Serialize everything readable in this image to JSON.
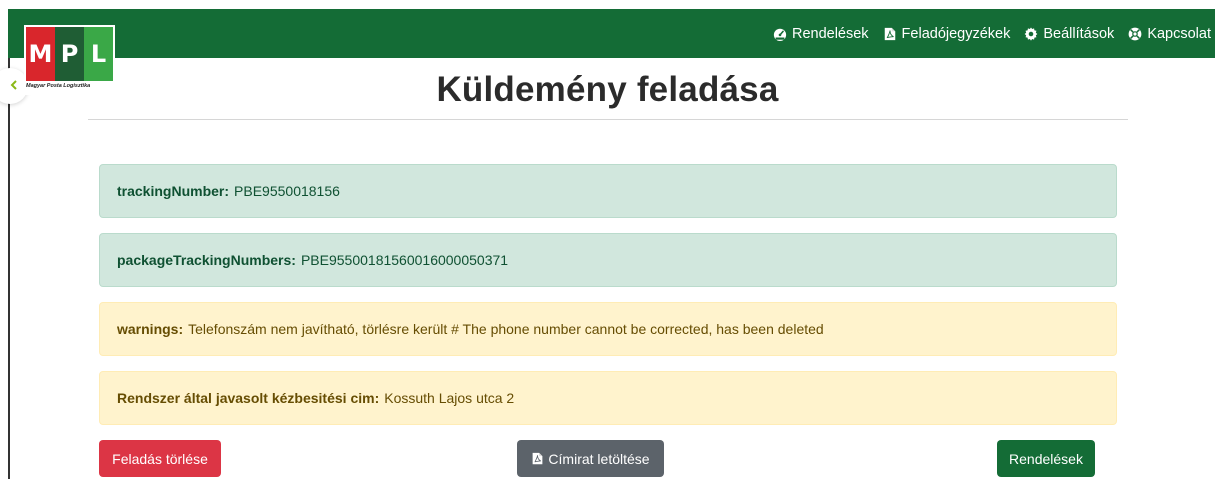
{
  "colors": {
    "brand_green": "#146c36",
    "success_bg": "#d1e7dd",
    "warning_bg": "#fff3cd",
    "danger": "#dc3545",
    "secondary": "#5c636a"
  },
  "logo": {
    "letters": [
      "M",
      "P",
      "L"
    ],
    "tagline": "Magyar Posta Logisztika"
  },
  "nav": {
    "items": [
      {
        "label": "Rendelések",
        "icon": "dashboard-icon"
      },
      {
        "label": "Feladójegyzékek",
        "icon": "pdf-file-icon"
      },
      {
        "label": "Beállítások",
        "icon": "gear-icon"
      },
      {
        "label": "Kapcsolat",
        "icon": "lifebuoy-icon"
      }
    ]
  },
  "page": {
    "title": "Küldemény feladása"
  },
  "results": [
    {
      "key": "trackingNumber:",
      "value": "PBE9550018156",
      "type": "success"
    },
    {
      "key": "packageTrackingNumbers:",
      "value": "PBE95500181560016000050371",
      "type": "success"
    },
    {
      "key": "warnings:",
      "value": "Telefonszám nem javítható, törlésre került # The phone number cannot be corrected, has been deleted",
      "type": "warning"
    },
    {
      "key": "Rendszer által javasolt kézbesitési cim:",
      "value": "Kossuth Lajos utca 2",
      "type": "warning"
    }
  ],
  "actions": {
    "delete_label": "Feladás törlése",
    "download_label": "Címirat letöltése",
    "download_icon": "pdf-file-icon",
    "orders_label": "Rendelések"
  }
}
